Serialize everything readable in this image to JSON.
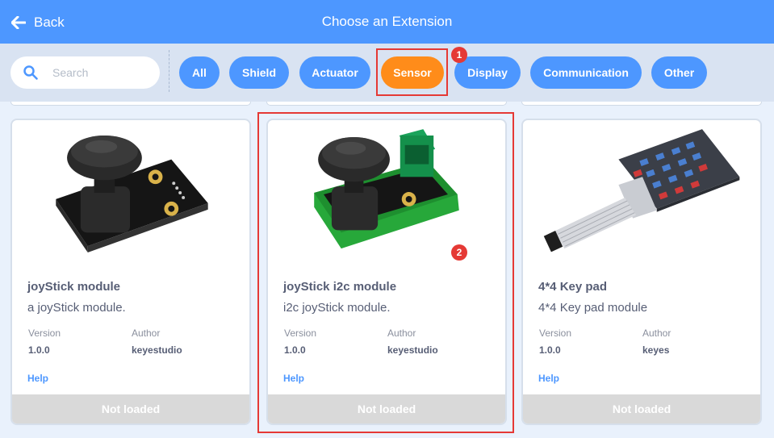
{
  "header": {
    "back_label": "Back",
    "title": "Choose an Extension"
  },
  "search": {
    "placeholder": "Search"
  },
  "filters": [
    {
      "label": "All"
    },
    {
      "label": "Shield"
    },
    {
      "label": "Actuator"
    },
    {
      "label": "Sensor",
      "selected": true
    },
    {
      "label": "Display"
    },
    {
      "label": "Communication"
    },
    {
      "label": "Other"
    }
  ],
  "annotations": {
    "badge1": "1",
    "badge2": "2",
    "color": "#e53935"
  },
  "labels": {
    "version": "Version",
    "author": "Author",
    "help": "Help"
  },
  "cards": [
    {
      "name": "joyStick module",
      "description": "a joyStick module.",
      "version": "1.0.0",
      "author": "keyestudio",
      "status": "Not loaded"
    },
    {
      "name": "joyStick i2c module",
      "description": "i2c joyStick module.",
      "version": "1.0.0",
      "author": "keyestudio",
      "status": "Not loaded"
    },
    {
      "name": "4*4 Key pad",
      "description": "4*4 Key pad module",
      "version": "1.0.0",
      "author": "keyes",
      "status": "Not loaded"
    }
  ],
  "colors": {
    "header": "#4d97ff",
    "chip": "#4d97ff",
    "chip_active": "#ff8c1a",
    "text": "#575e75",
    "status_bg": "#d9d9d9"
  }
}
